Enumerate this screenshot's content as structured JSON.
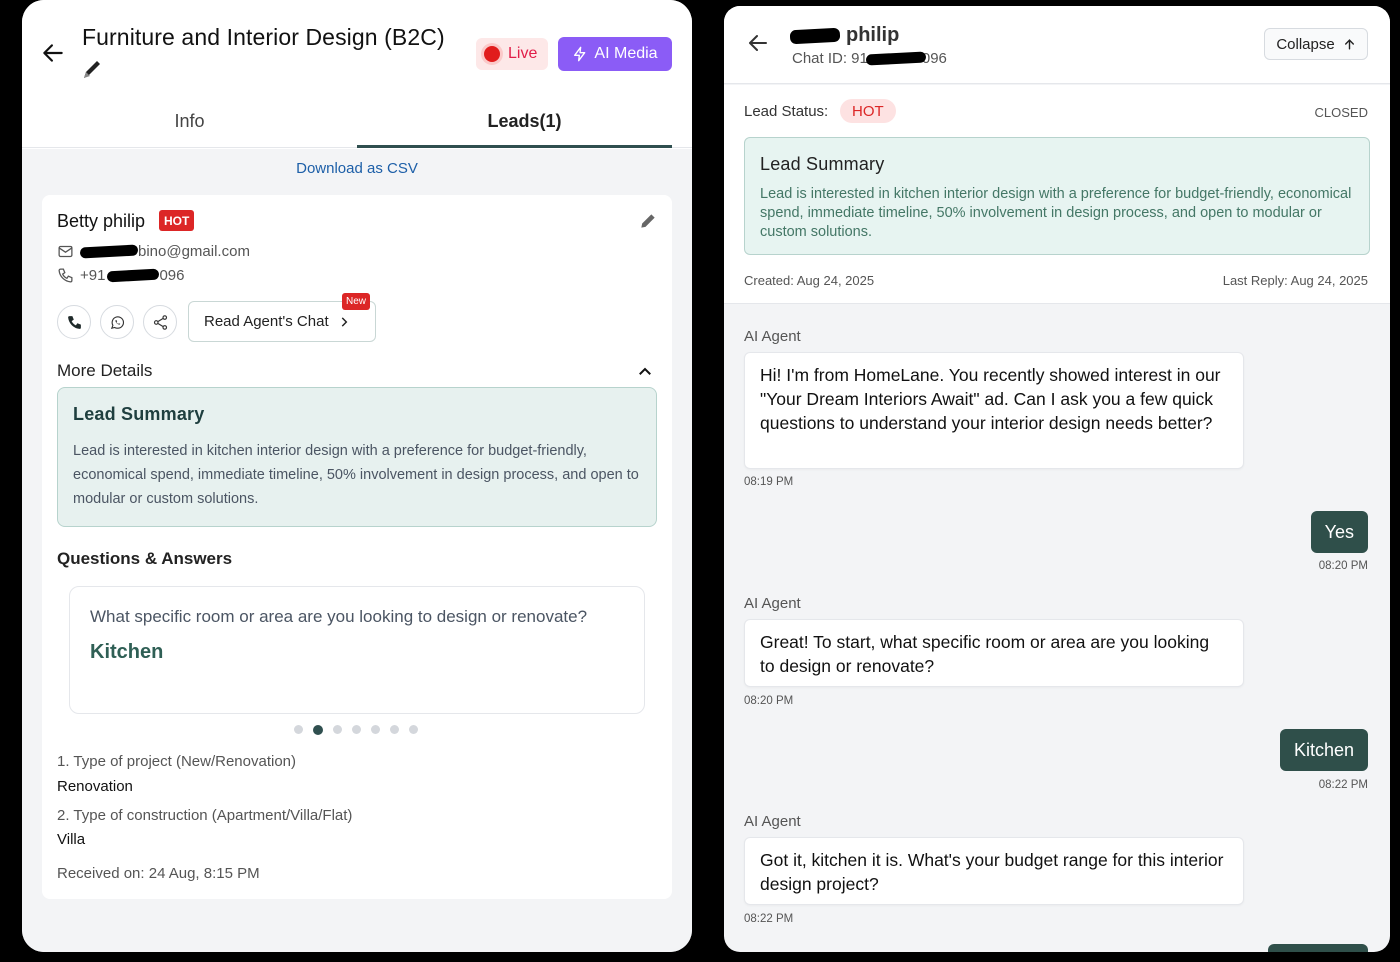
{
  "left": {
    "title": "Furniture and Interior Design (B2C)",
    "live_label": "Live",
    "ai_media_label": "AI Media",
    "tabs": [
      {
        "label": "Info"
      },
      {
        "label": "Leads(1)"
      }
    ],
    "download_csv": "Download as CSV",
    "lead": {
      "name": "Betty philip",
      "status": "HOT",
      "email_visible": "bino@gmail.com",
      "phone_prefix": "+91",
      "phone_suffix": "096",
      "read_chat_label": "Read Agent's Chat",
      "new_badge": "New",
      "more_details": "More Details",
      "summary_title": "Lead Summary",
      "summary_text": "Lead is interested in kitchen interior design with a preference for budget-friendly, economical spend, immediate timeline, 50% involvement in design process, and open to modular or custom solutions.",
      "qa_title": "Questions & Answers",
      "qa_question": "What specific room or area are you looking to design or renovate?",
      "qa_answer": "Kitchen",
      "details": [
        {
          "q": "1. Type of project (New/Renovation)",
          "a": "Renovation"
        },
        {
          "q": "2. Type of construction (Apartment/Villa/Flat)",
          "a": "Villa"
        }
      ],
      "received": "Received on: 24 Aug, 8:15 PM"
    }
  },
  "right": {
    "name_visible": "philip",
    "chat_id_prefix": "Chat ID: 91",
    "chat_id_suffix": "096",
    "collapse_label": "Collapse",
    "lead_status_label": "Lead Status:",
    "lead_status": "HOT",
    "closed_label": "CLOSED",
    "summary_title": "Lead Summary",
    "summary_text": "Lead is interested in kitchen interior design with a preference for budget-friendly, economical spend, immediate timeline, 50% involvement in design process, and open to modular or custom solutions.",
    "created": "Created: Aug 24, 2025",
    "last_reply": "Last Reply: Aug 24, 2025",
    "messages": [
      {
        "sender": "AI Agent",
        "text": "Hi! I'm from HomeLane. You recently showed interest in our \"Your Dream Interiors Await\" ad. Can I ask you a few quick questions to understand your interior design needs better?",
        "time": "08:19 PM"
      },
      {
        "sender": "user",
        "text": "Yes",
        "time": "08:20 PM"
      },
      {
        "sender": "AI Agent",
        "text": "Great! To start, what specific room or area are you looking to design or renovate?",
        "time": "08:20 PM"
      },
      {
        "sender": "user",
        "text": "Kitchen",
        "time": "08:22 PM"
      },
      {
        "sender": "AI Agent",
        "text": "Got it, kitchen it is. What's your budget range for this interior design project?",
        "time": "08:22 PM"
      }
    ]
  },
  "colors": {
    "accent": "#8b5cf6",
    "hot": "#dc2626",
    "teal_dark": "#2f4f4a",
    "summary_bg": "#e7f1ef",
    "link": "#1d5fa8"
  }
}
